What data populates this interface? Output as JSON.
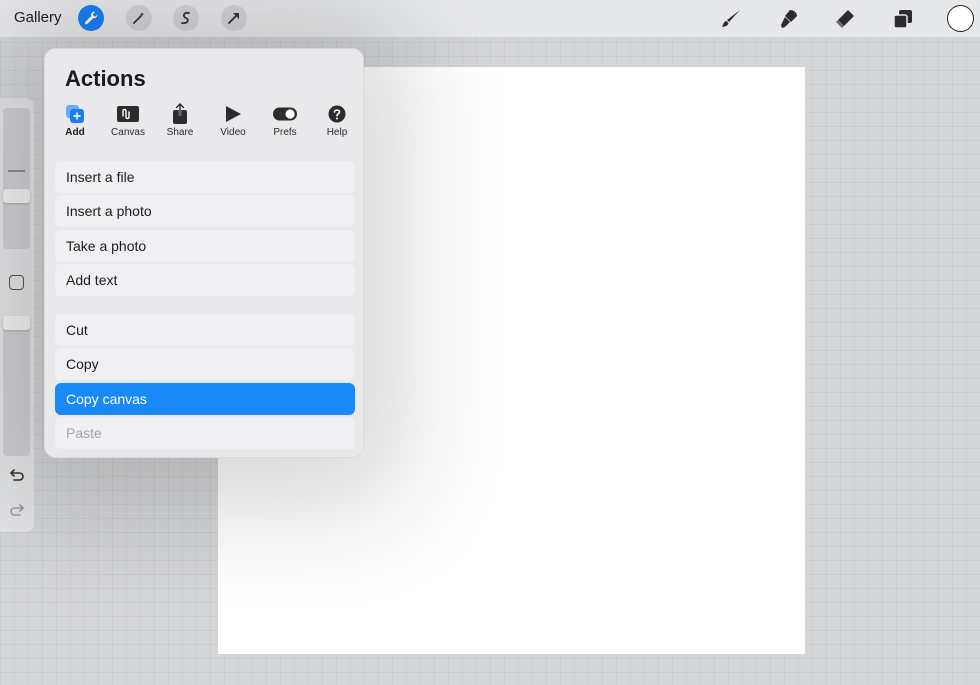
{
  "topbar": {
    "gallery": "Gallery",
    "left_tools": [
      "wrench-icon",
      "magic-wand-icon",
      "selection-icon",
      "transform-arrow-icon"
    ],
    "right_tools": [
      "brush-icon",
      "smudge-icon",
      "eraser-icon",
      "layers-icon"
    ],
    "color": "#ffffff",
    "accent": "#1a7ff5"
  },
  "actions_panel": {
    "title": "Actions",
    "tabs": [
      {
        "label": "Add",
        "icon": "add-icon",
        "active": true
      },
      {
        "label": "Canvas",
        "icon": "canvas-icon"
      },
      {
        "label": "Share",
        "icon": "share-icon"
      },
      {
        "label": "Video",
        "icon": "video-icon"
      },
      {
        "label": "Prefs",
        "icon": "toggle-icon"
      },
      {
        "label": "Help",
        "icon": "help-icon"
      }
    ],
    "group1": [
      "Insert a file",
      "Insert a photo",
      "Take a photo",
      "Add text"
    ],
    "group2": [
      "Cut",
      "Copy",
      "Copy canvas",
      "Paste"
    ],
    "selected_item": "Copy canvas",
    "disabled_item": "Paste",
    "selected_color": "#1a89f8"
  },
  "sidebar": {
    "icons": [
      "brush-size-slider",
      "modify-square-icon",
      "brush-opacity-slider",
      "undo-icon",
      "redo-icon"
    ]
  }
}
